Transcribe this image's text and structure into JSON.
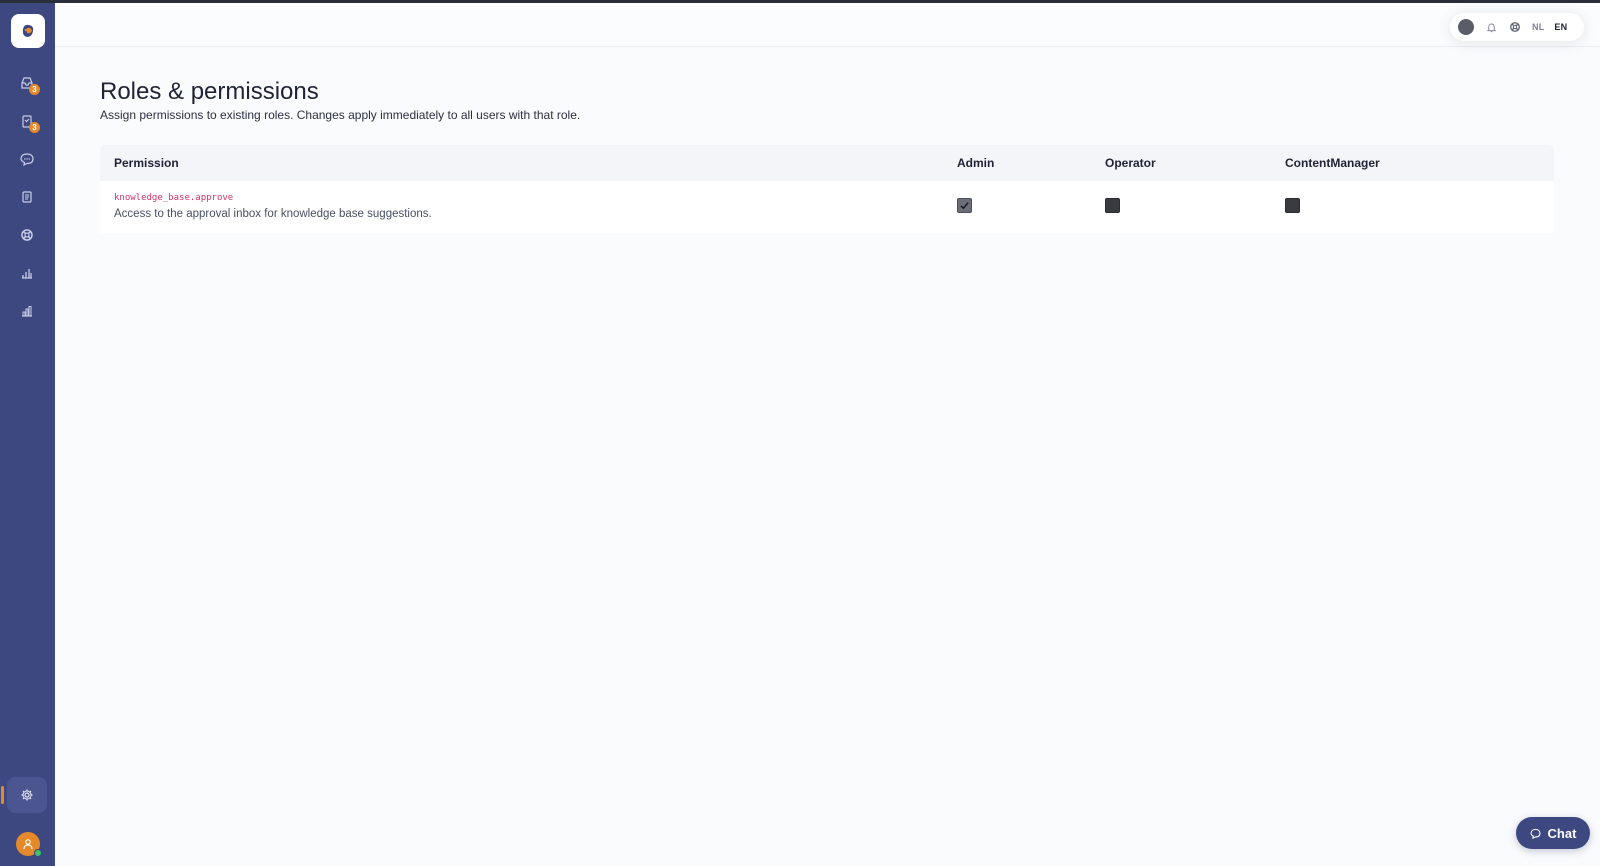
{
  "app": {
    "nav_badges": {
      "inbox": "3",
      "tasks": "3"
    },
    "language": {
      "options": [
        "NL",
        "EN"
      ],
      "selected": "EN"
    }
  },
  "page": {
    "title": "Roles & permissions",
    "subtitle": "Assign permissions to existing roles. Changes apply immediately to all users with that role."
  },
  "table": {
    "headers": {
      "permission": "Permission",
      "roles": [
        "Admin",
        "Operator",
        "ContentManager"
      ]
    },
    "rows": [
      {
        "key": "knowledge_base.approve",
        "description": "Access to the approval inbox for knowledge base suggestions.",
        "grants": [
          true,
          false,
          false
        ]
      }
    ]
  },
  "chat": {
    "label": "Chat"
  },
  "colors": {
    "sidebar": "#3d4780",
    "accent": "#e58a2a",
    "permission_key": "#d0336c",
    "presence": "#3fc36b"
  },
  "icons": {
    "sidebar": [
      "inbox-icon",
      "tasks-icon",
      "chat-bubble-icon",
      "document-icon",
      "support-icon",
      "analytics-icon",
      "bar-chart-icon",
      "gear-icon",
      "user-icon"
    ],
    "header": [
      "theme-toggle-icon",
      "bell-icon",
      "help-icon"
    ]
  }
}
